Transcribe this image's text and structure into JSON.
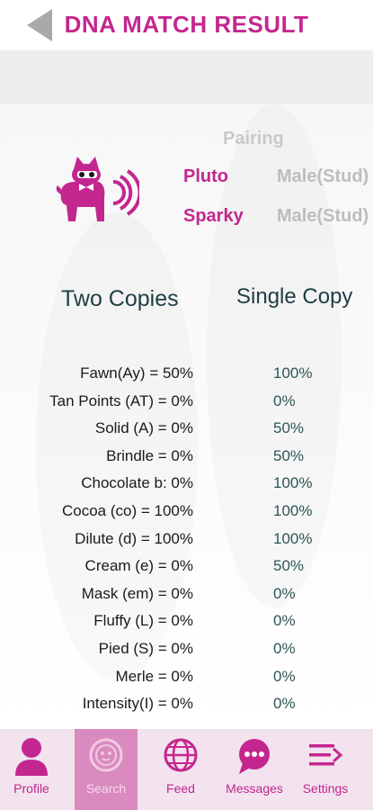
{
  "header": {
    "title": "DNA MATCH RESULT"
  },
  "pairing": {
    "label": "Pairing",
    "dogs": [
      {
        "name": "Pluto",
        "sex": "Male(Stud)"
      },
      {
        "name": "Sparky",
        "sex": "Male(Stud)"
      }
    ]
  },
  "columns": {
    "left": "Two Copies",
    "right": "Single Copy"
  },
  "rows": [
    {
      "label": "Fawn(Ay) = 50%",
      "value": "100%"
    },
    {
      "label": "Tan Points (AT)  = 0%",
      "value": "0%"
    },
    {
      "label": "Solid (A)  = 0%",
      "value": "50%"
    },
    {
      "label": "Brindle  = 0%",
      "value": "50%"
    },
    {
      "label": "Chocolate b: 0%",
      "value": "100%"
    },
    {
      "label": "Cocoa (co) = 100%",
      "value": "100%"
    },
    {
      "label": "Dilute (d) = 100%",
      "value": "100%"
    },
    {
      "label": "Cream (e) = 0%",
      "value": "50%"
    },
    {
      "label": "Mask (em) = 0%",
      "value": "0%"
    },
    {
      "label": "Fluffy (L)  = 0%",
      "value": "0%"
    },
    {
      "label": "Pied (S) = 0%",
      "value": "0%"
    },
    {
      "label": "Merle  = 0%",
      "value": "0%"
    },
    {
      "label": "Intensity(I) = 0%",
      "value": "0%"
    }
  ],
  "tabs": [
    {
      "label": "Profile",
      "icon": "person-icon"
    },
    {
      "label": "Search",
      "icon": "search-dog-icon",
      "active": true
    },
    {
      "label": "Feed",
      "icon": "globe-icon"
    },
    {
      "label": "Messages",
      "icon": "chat-icon"
    },
    {
      "label": "Settings",
      "icon": "menu-arrow-icon"
    }
  ],
  "colors": {
    "accent": "#c4268f",
    "tabbar": "#f2e3ee",
    "active_tab": "#d98abf",
    "value_text": "#2c5555"
  }
}
